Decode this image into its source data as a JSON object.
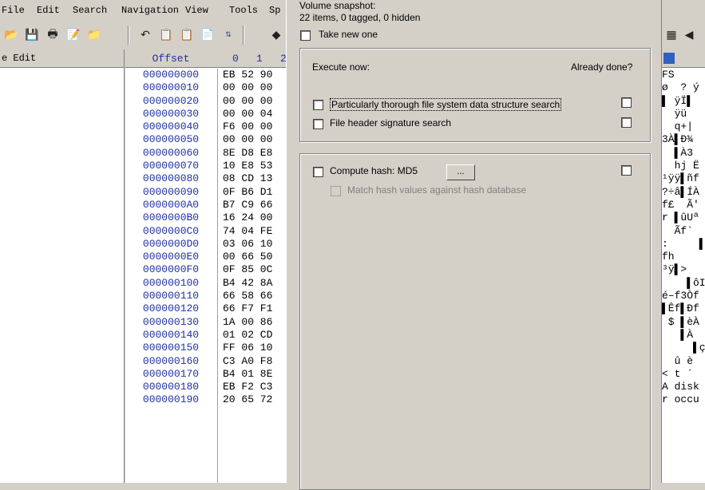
{
  "menu": [
    "File",
    "Edit",
    "Search",
    "Navigation",
    "View",
    "Tools",
    "Sp"
  ],
  "left_panel": {
    "header": "e Edit"
  },
  "hex": {
    "offset_header": "Offset",
    "col_labels": [
      "0",
      "1",
      "2"
    ],
    "rows": [
      {
        "off": "000000000",
        "hex": "EB 52 90"
      },
      {
        "off": "000000010",
        "hex": "00 00 00"
      },
      {
        "off": "000000020",
        "hex": "00 00 00"
      },
      {
        "off": "000000030",
        "hex": "00 00 04"
      },
      {
        "off": "000000040",
        "hex": "F6 00 00"
      },
      {
        "off": "000000050",
        "hex": "00 00 00"
      },
      {
        "off": "000000060",
        "hex": "8E D8 E8"
      },
      {
        "off": "000000070",
        "hex": "10 E8 53"
      },
      {
        "off": "000000080",
        "hex": "08 CD 13"
      },
      {
        "off": "000000090",
        "hex": "0F B6 D1"
      },
      {
        "off": "0000000A0",
        "hex": "B7 C9 66"
      },
      {
        "off": "0000000B0",
        "hex": "16 24 00"
      },
      {
        "off": "0000000C0",
        "hex": "74 04 FE"
      },
      {
        "off": "0000000D0",
        "hex": "03 06 10"
      },
      {
        "off": "0000000E0",
        "hex": "00 66 50"
      },
      {
        "off": "0000000F0",
        "hex": "0F 85 0C"
      },
      {
        "off": "000000100",
        "hex": "B4 42 8A"
      },
      {
        "off": "000000110",
        "hex": "66 58 66"
      },
      {
        "off": "000000120",
        "hex": "66 F7 F1"
      },
      {
        "off": "000000130",
        "hex": "1A 00 86"
      },
      {
        "off": "000000140",
        "hex": "01 02 CD"
      },
      {
        "off": "000000150",
        "hex": "FF 06 10"
      },
      {
        "off": "000000160",
        "hex": "C3 A0 F8"
      },
      {
        "off": "000000170",
        "hex": "B4 01 8E"
      },
      {
        "off": "000000180",
        "hex": "EB F2 C3"
      },
      {
        "off": "000000190",
        "hex": "20 65 72"
      }
    ]
  },
  "dialog": {
    "snapshot_title": "Volume snapshot:",
    "snapshot_status": "22 items, 0 tagged, 0 hidden",
    "take_new": "Take new one",
    "execute_now": "Execute now:",
    "already_done": "Already done?",
    "thorough_search": "Particularly thorough file system data structure search",
    "header_search": "File header signature search",
    "compute_hash": "Compute hash: MD5",
    "hash_button": "...",
    "match_hash": "Match hash values against hash database"
  },
  "ascii_rows": [
    "FS",
    "ø  ? ý",
    "▌ ÿÏ▌",
    "  ÿü",
    "  q+|",
    "3À▌Ð¾",
    "  ▌À3",
    "  hj Ë",
    "¹ÿÿ▌ñf",
    "?÷â▌ÍÀ",
    "f£  Ã'",
    "r ▌ûUª",
    "  Ãf`",
    ":     ▌",
    "fh",
    "³ÿ▌>",
    "    ▌ôI",
    "é–f3Òf",
    "▌Êf▌Ðf",
    " $ ▌èÀ",
    "   ▌À",
    "     ▌ç",
    "  û è",
    "< t ´",
    "A disk",
    "r occu"
  ]
}
